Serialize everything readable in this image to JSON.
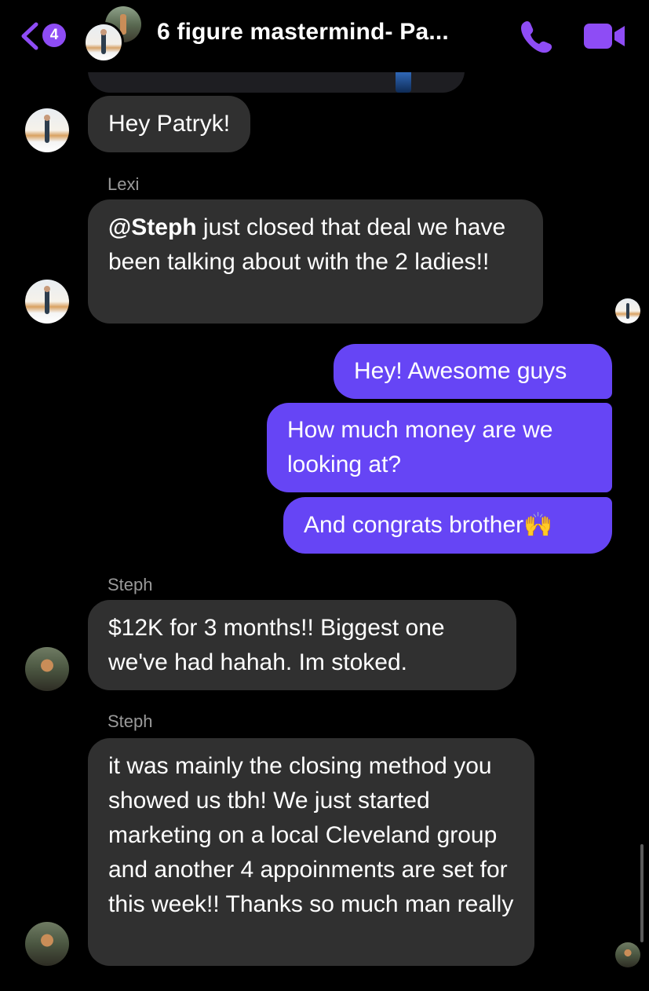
{
  "header": {
    "back_badge": "4",
    "title": "6 figure mastermind- Pa...",
    "icons": {
      "back": "chevron-left-icon",
      "call": "phone-icon",
      "video": "video-camera-icon"
    },
    "accent_color": "#8e4cf5"
  },
  "messages": [
    {
      "id": "m1",
      "direction": "incoming",
      "text": "Hey Patryk!"
    },
    {
      "id": "m2",
      "direction": "incoming",
      "sender": "Lexi",
      "mention": "@Steph",
      "text": " just closed that deal we have been talking about with the 2 ladies!!"
    },
    {
      "id": "m3",
      "direction": "outgoing",
      "text": "Hey! Awesome guys"
    },
    {
      "id": "m4",
      "direction": "outgoing",
      "text": "How much money are we looking at?"
    },
    {
      "id": "m5",
      "direction": "outgoing",
      "text": "And congrats brother🙌"
    },
    {
      "id": "m6",
      "direction": "incoming",
      "sender": "Steph",
      "text": "$12K for 3 months!! Biggest one we've had hahah. Im stoked."
    },
    {
      "id": "m7",
      "direction": "incoming",
      "sender": "Steph",
      "text": "it was mainly the closing method you showed us tbh! We just started marketing on a local Cleveland group and another 4 appoinments are set for this week!! Thanks so much man really"
    }
  ],
  "colors": {
    "incoming_bubble": "#303030",
    "outgoing_bubble": "#6645f5",
    "background": "#000000",
    "sender_label": "#9a9a9a"
  }
}
